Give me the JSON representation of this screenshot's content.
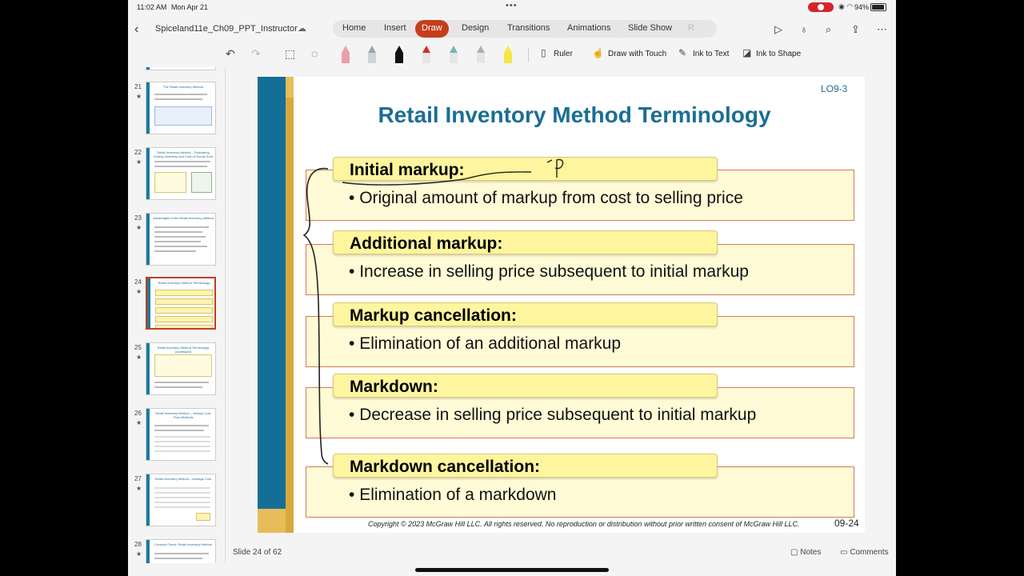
{
  "status": {
    "time": "11:02 AM",
    "date": "Mon Apr 21",
    "battery": "94%"
  },
  "header": {
    "doc_name": "Spiceland11e_Ch09_PPT_Instructor",
    "tabs": [
      "Home",
      "Insert",
      "Draw",
      "Design",
      "Transitions",
      "Animations",
      "Slide Show",
      "R"
    ],
    "active_tab": "Draw"
  },
  "draw_toolbar": {
    "ruler": "Ruler",
    "draw_with_touch": "Draw with Touch",
    "ink_to_text": "Ink to Text",
    "ink_to_shape": "Ink to Shape",
    "pens": [
      {
        "name": "eraser",
        "color": "#e8a0a8"
      },
      {
        "name": "pencil",
        "color": "#9aa3ad"
      },
      {
        "name": "pen-black",
        "color": "#111111"
      },
      {
        "name": "pen-red",
        "color": "#d22c2c"
      },
      {
        "name": "pen-teal",
        "color": "#6fb6b4"
      },
      {
        "name": "pen-gray",
        "color": "#a8b0b8"
      },
      {
        "name": "highlighter-yellow",
        "color": "#f3e64a"
      }
    ]
  },
  "sidebar": {
    "thumbnails": [
      {
        "num": "21",
        "title": "The Retail Inventory Method"
      },
      {
        "num": "22",
        "title": "Retail Inventory Method – Estimating Ending Inventory and Cost of Goods Sold"
      },
      {
        "num": "23",
        "title": "Advantages of the Retail Inventory Method"
      },
      {
        "num": "24",
        "title": "Retail Inventory Method Terminology",
        "selected": true
      },
      {
        "num": "25",
        "title": "Retail Inventory Method Terminology (continued)"
      },
      {
        "num": "26",
        "title": "Retail Inventory Method – Various Cost Flow Methods"
      },
      {
        "num": "27",
        "title": "Retail Inventory Method – Average Cost"
      },
      {
        "num": "28",
        "title": "Concept Check: Retail Inventory Method"
      }
    ]
  },
  "slide": {
    "lo": "LO9-3",
    "title": "Retail Inventory Method Terminology",
    "terms": [
      {
        "label": "Initial markup:",
        "desc": "Original amount of markup from cost to selling price"
      },
      {
        "label": "Additional markup:",
        "desc": "Increase in selling price subsequent to initial markup"
      },
      {
        "label": "Markup cancellation:",
        "desc": "Elimination of an additional markup"
      },
      {
        "label": "Markdown:",
        "desc": "Decrease in selling price subsequent to initial markup"
      },
      {
        "label": "Markdown cancellation:",
        "desc": "Elimination of a markdown"
      }
    ],
    "copyright": "Copyright © 2023 McGraw Hill LLC. All rights reserved. No reproduction or distribution without prior written consent of McGraw Hill LLC.",
    "slide_number": "09-24"
  },
  "footer": {
    "slide_count": "Slide 24 of 62",
    "notes": "Notes",
    "comments": "Comments"
  }
}
